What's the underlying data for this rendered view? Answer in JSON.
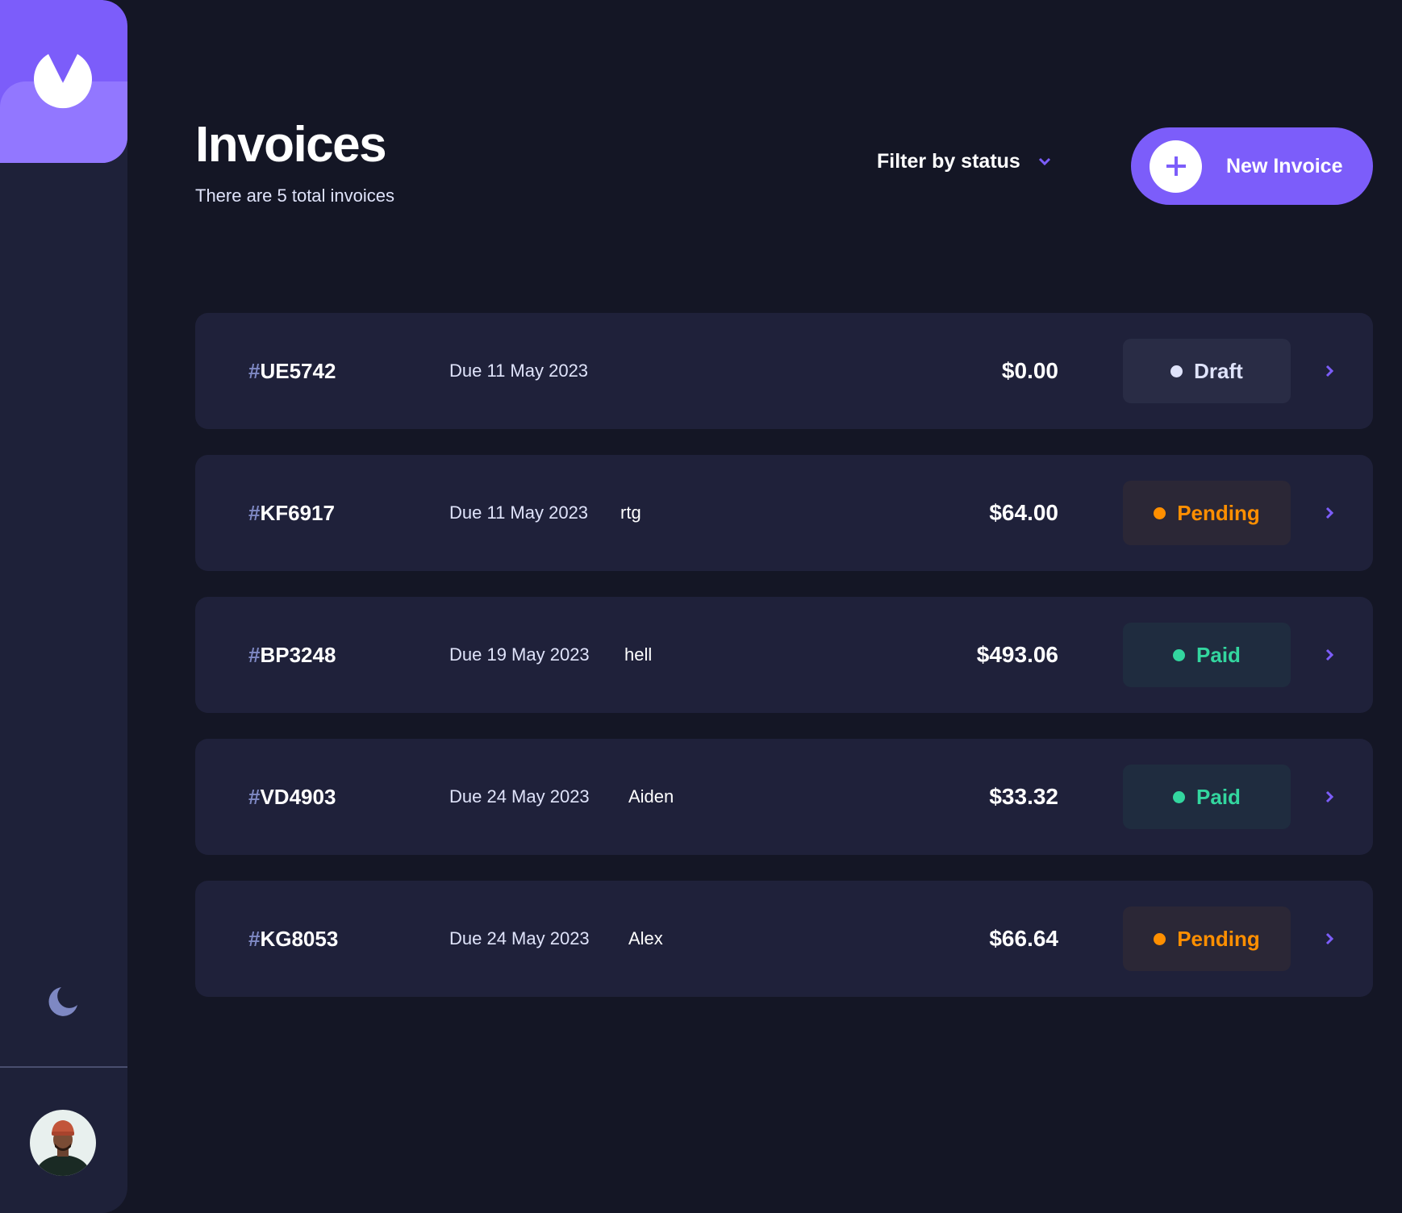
{
  "colors": {
    "accent": "#7c5dfa",
    "accent_light": "#9277ff",
    "background": "#141625",
    "sidebar": "#1e2139",
    "row": "#1f213a",
    "draft": "#dfe3fa",
    "pending": "#ff8f00",
    "paid": "#33d69f"
  },
  "sidebar": {
    "logo_icon": "logo-icon",
    "theme_toggle_icon": "moon-icon",
    "avatar_icon": "avatar"
  },
  "header": {
    "title": "Invoices",
    "subtitle": "There are 5 total invoices",
    "filter_label": "Filter by status",
    "filter_icon": "chevron-down-icon",
    "new_invoice_label": "New Invoice",
    "new_invoice_icon": "plus-icon"
  },
  "invoices": [
    {
      "hash": "#",
      "id": "UE5742",
      "due": "Due 11 May 2023",
      "client": "",
      "amount": "$0.00",
      "status": "Draft",
      "status_key": "draft"
    },
    {
      "hash": "#",
      "id": "KF6917",
      "due": "Due 11 May 2023",
      "client": "rtg",
      "amount": "$64.00",
      "status": "Pending",
      "status_key": "pending"
    },
    {
      "hash": "#",
      "id": "BP3248",
      "due": "Due 19 May 2023",
      "client": "hell",
      "amount": "$493.06",
      "status": "Paid",
      "status_key": "paid"
    },
    {
      "hash": "#",
      "id": "VD4903",
      "due": "Due 24 May 2023",
      "client": "Aiden",
      "amount": "$33.32",
      "status": "Paid",
      "status_key": "paid"
    },
    {
      "hash": "#",
      "id": "KG8053",
      "due": "Due 24 May 2023",
      "client": "Alex",
      "amount": "$66.64",
      "status": "Pending",
      "status_key": "pending"
    }
  ]
}
